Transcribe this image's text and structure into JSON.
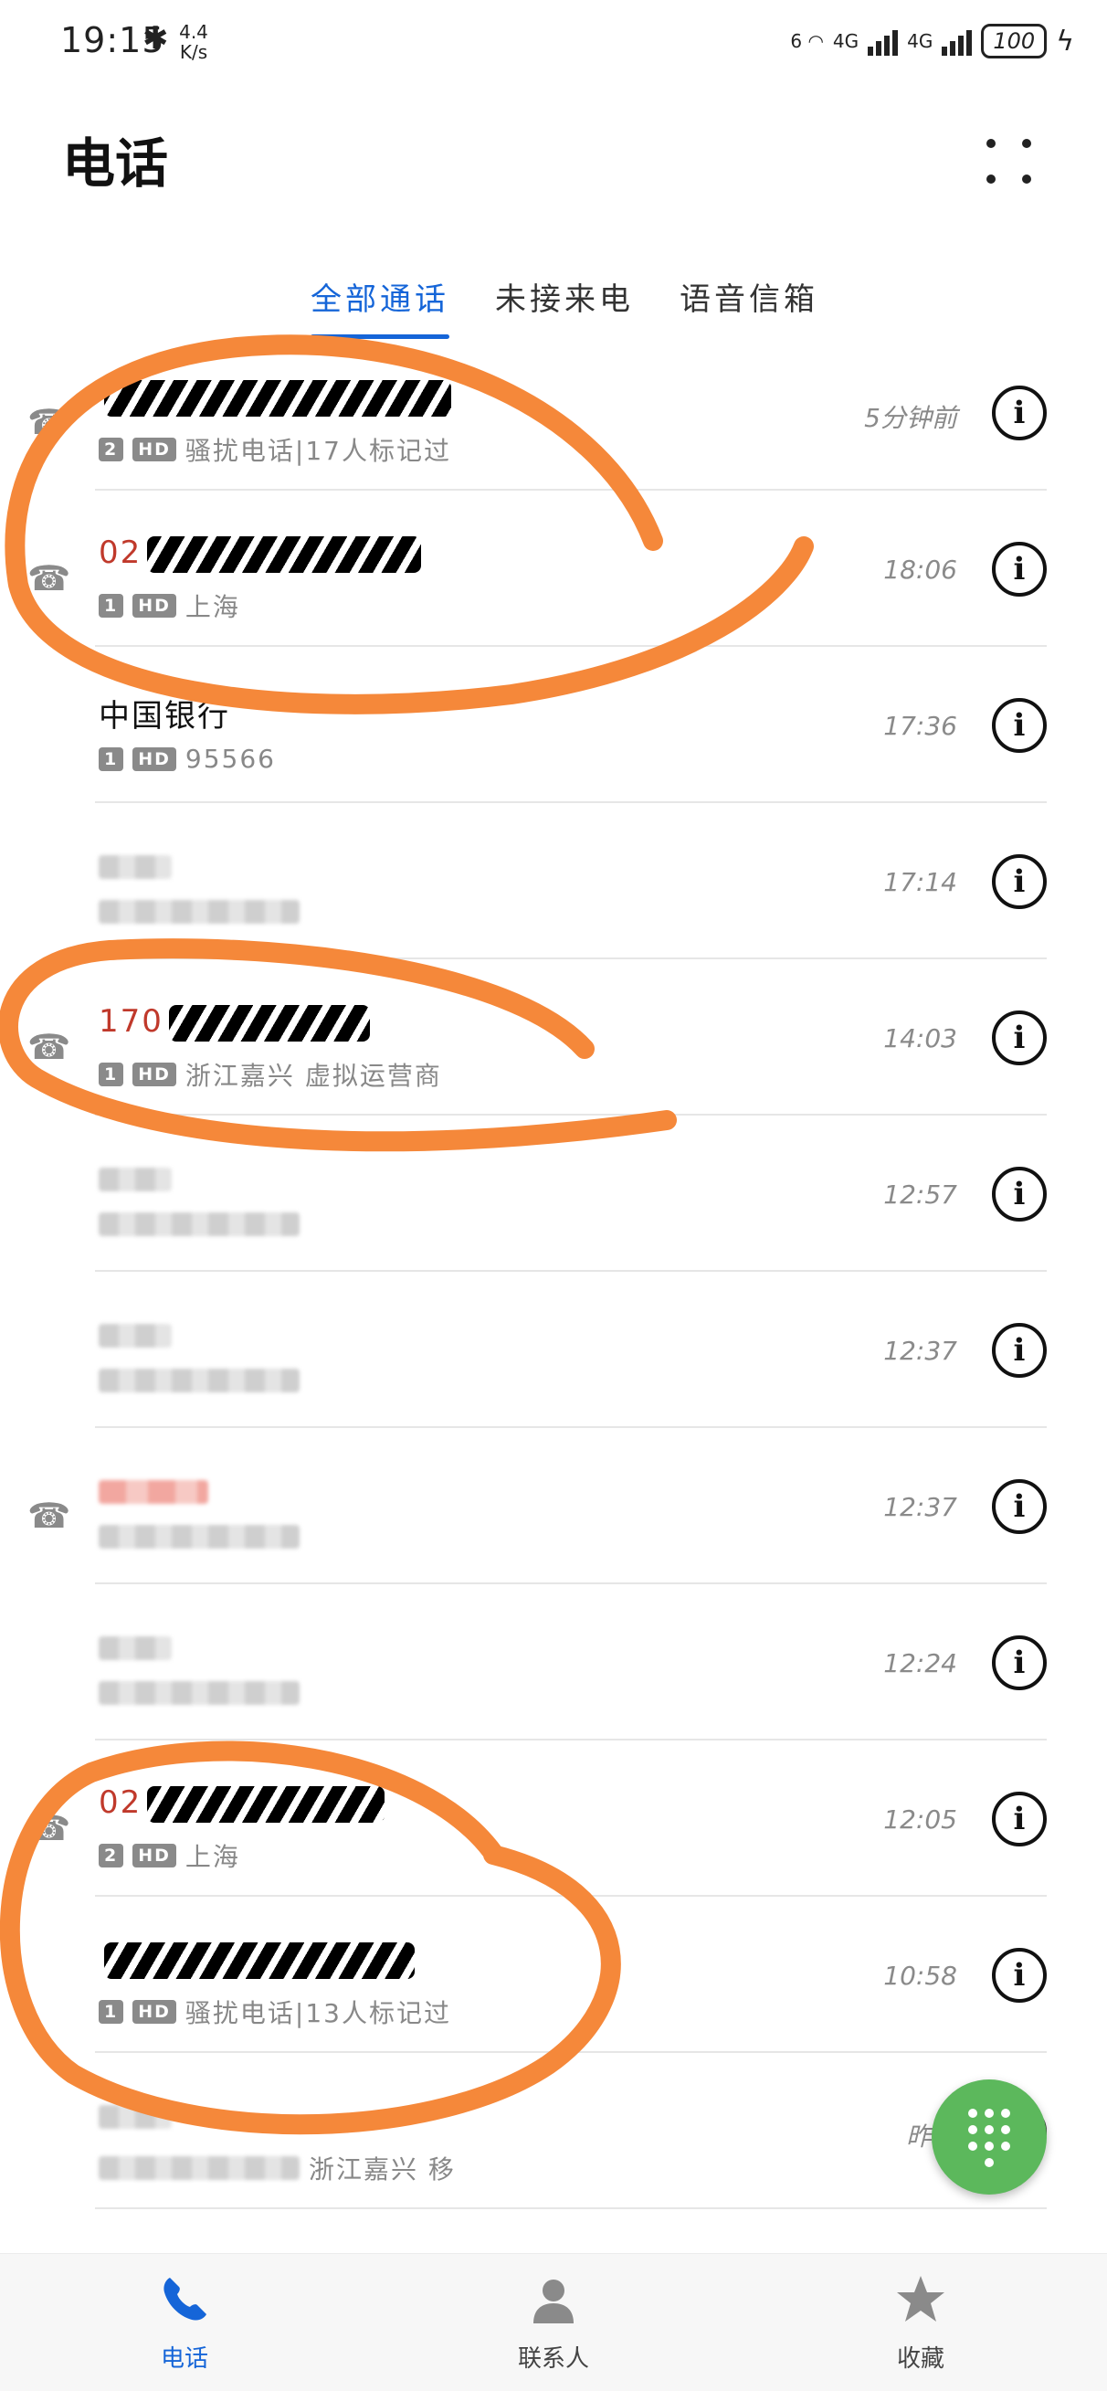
{
  "status_bar": {
    "time": "19:15",
    "net_speed": "4.4 K/s",
    "wifi_label": "6",
    "sim1_label": "4G",
    "sim2_label": "4G",
    "battery": "100"
  },
  "header": {
    "title": "电话"
  },
  "tabs": [
    {
      "label": "全部通话",
      "active": true
    },
    {
      "label": "未接来电",
      "active": false
    },
    {
      "label": "语音信箱",
      "active": false
    }
  ],
  "calls": [
    {
      "name": "",
      "missed": true,
      "sim": "2",
      "hd": "HD",
      "detail": "骚扰电话|17人标记过",
      "time": "5分钟前"
    },
    {
      "name": "02",
      "missed": true,
      "sim": "1",
      "hd": "HD",
      "detail": "上海",
      "time": "18:06"
    },
    {
      "name": "中国银行",
      "missed": false,
      "sim": "1",
      "hd": "HD",
      "detail": "95566",
      "time": "17:36"
    },
    {
      "name": "",
      "missed": false,
      "sim": "",
      "hd": "",
      "detail": "",
      "time": "17:14"
    },
    {
      "name": "170",
      "missed": true,
      "sim": "1",
      "hd": "HD",
      "detail": "浙江嘉兴 虚拟运营商",
      "time": "14:03"
    },
    {
      "name": "",
      "missed": false,
      "sim": "",
      "hd": "",
      "detail": "",
      "time": "12:57"
    },
    {
      "name": "",
      "missed": false,
      "sim": "",
      "hd": "",
      "detail": "",
      "time": "12:37"
    },
    {
      "name": "",
      "missed": true,
      "sim": "",
      "hd": "",
      "detail": "",
      "time": "12:37"
    },
    {
      "name": "",
      "missed": false,
      "sim": "",
      "hd": "",
      "detail": "",
      "time": "12:24"
    },
    {
      "name": "02",
      "missed": true,
      "sim": "2",
      "hd": "HD",
      "detail": "上海",
      "time": "12:05"
    },
    {
      "name": "",
      "missed": false,
      "sim": "1",
      "hd": "HD",
      "detail": "骚扰电话|13人标记过",
      "time": "10:58"
    },
    {
      "name": "",
      "missed": false,
      "sim": "",
      "hd": "",
      "detail": "浙江嘉兴 移",
      "time": "昨天"
    }
  ],
  "info_glyph": "i",
  "bottom_nav": [
    {
      "label": "电话",
      "icon": "phone-icon",
      "active": true
    },
    {
      "label": "联系人",
      "icon": "contact-icon",
      "active": false
    },
    {
      "label": "收藏",
      "icon": "star-icon",
      "active": false
    }
  ],
  "colors": {
    "accent": "#1565d8",
    "missed": "#c0392b",
    "fab": "#5cb85c",
    "annotation": "#f5883a"
  }
}
